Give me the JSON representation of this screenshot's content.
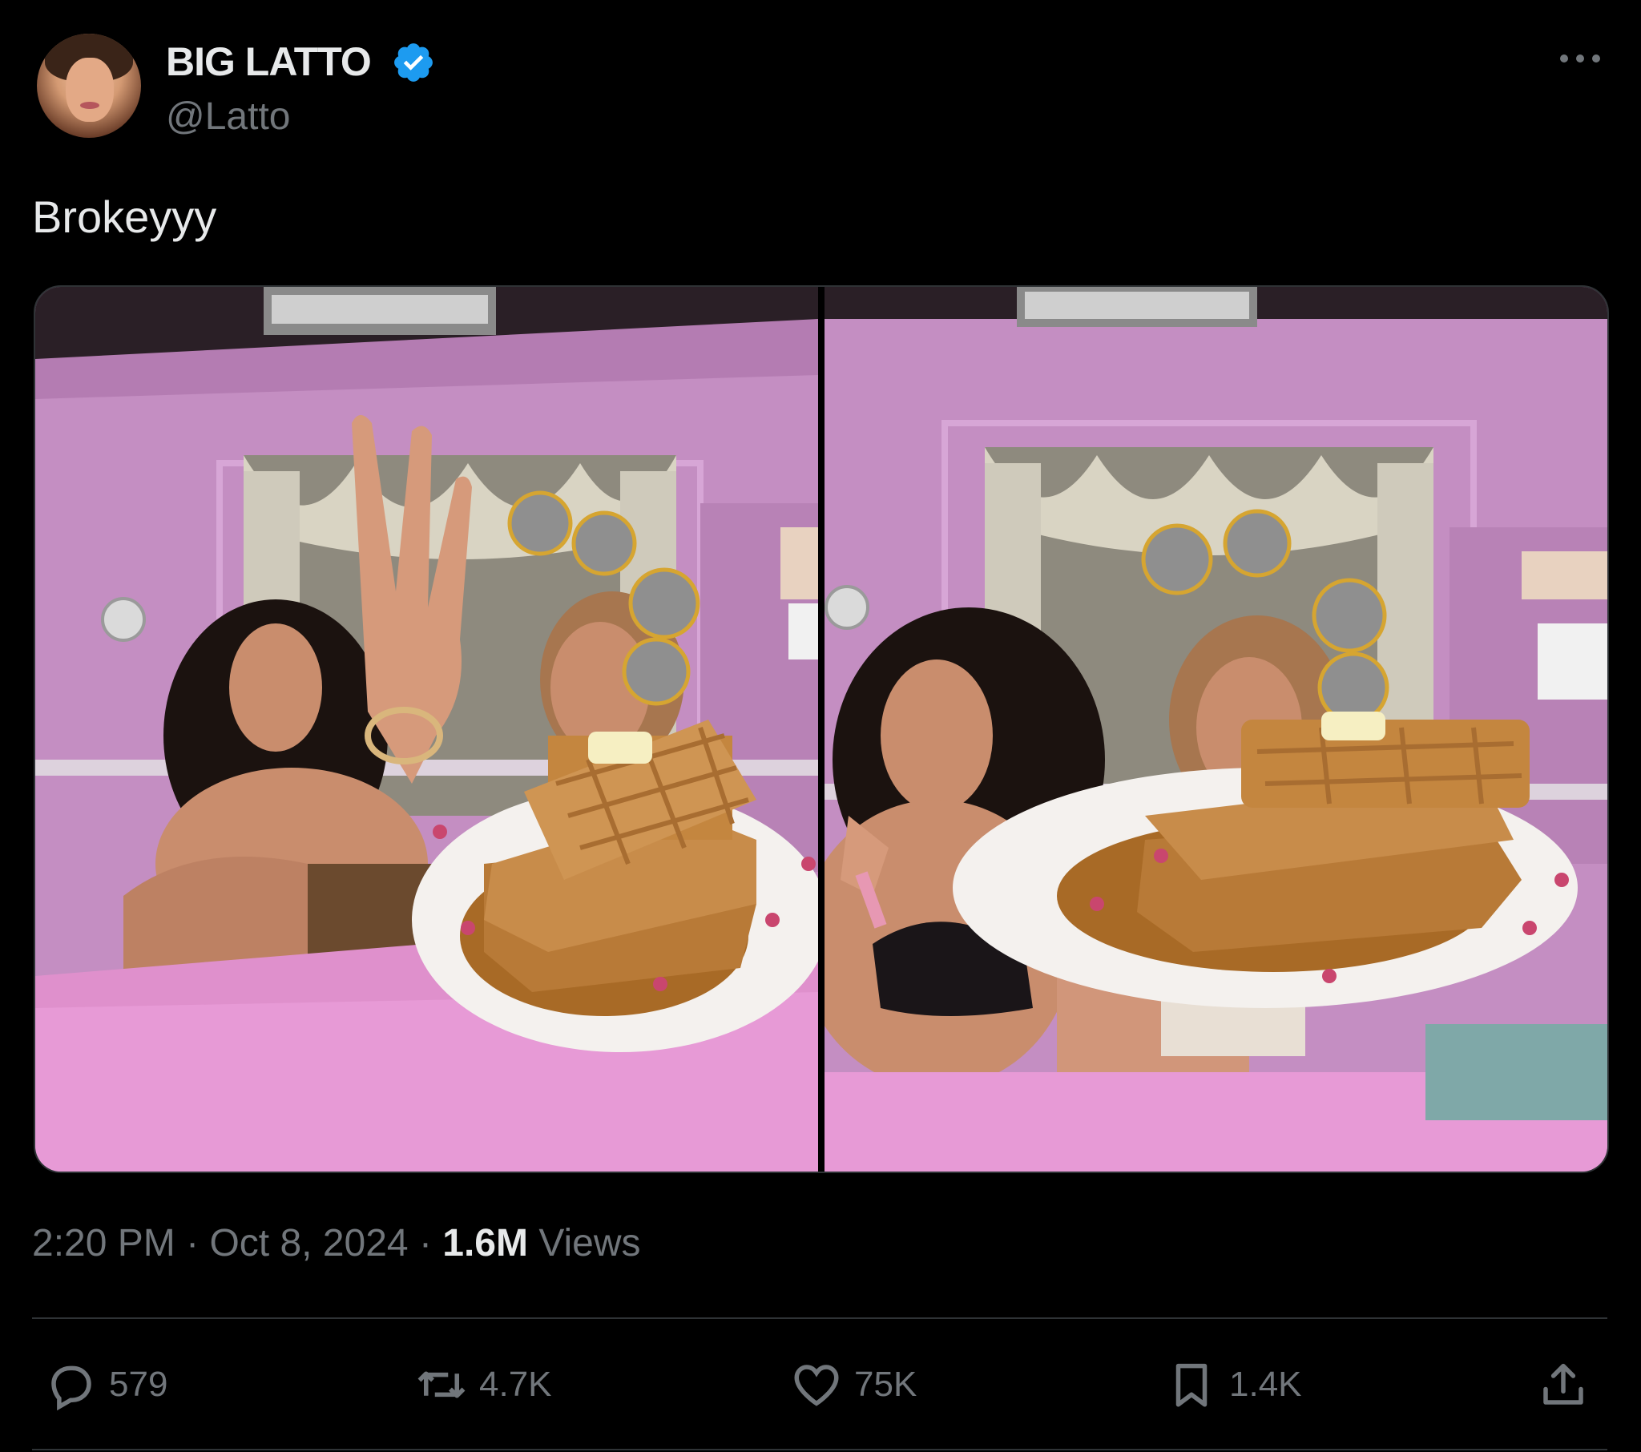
{
  "author": {
    "display_name": "BIG LATTO",
    "handle": "@Latto",
    "verified": true,
    "verified_color": "#1d9bf0"
  },
  "tweet": {
    "text": "Brokeyyy"
  },
  "media": {
    "count": 2,
    "wall_color": "#c48ec2",
    "table_color": "#e79ad6"
  },
  "meta": {
    "time": "2:20 PM",
    "separator": "·",
    "date": "Oct 8, 2024",
    "views_count": "1.6M",
    "views_label": "Views"
  },
  "actions": {
    "replies": "579",
    "reposts": "4.7K",
    "likes": "75K",
    "bookmarks": "1.4K"
  },
  "icons": [
    "more-icon",
    "verified-badge-icon",
    "reply-icon",
    "repost-icon",
    "like-icon",
    "bookmark-icon",
    "share-icon"
  ],
  "colors": {
    "background": "#000000",
    "text_primary": "#e7e9ea",
    "text_secondary": "#71767b",
    "divider": "#2f3336"
  }
}
